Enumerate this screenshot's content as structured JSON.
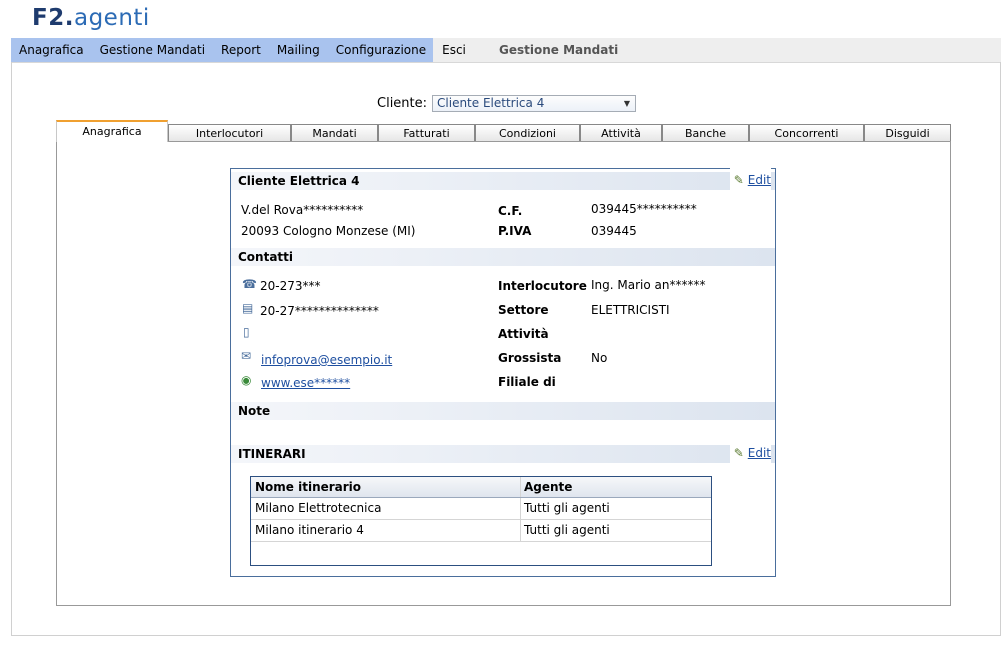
{
  "logo": {
    "part1": "F2",
    "part2": ".",
    "part3": "agenti"
  },
  "menu": {
    "items": [
      "Anagrafica",
      "Gestione Mandati",
      "Report",
      "Mailing",
      "Configurazione",
      "Esci"
    ]
  },
  "page_heading": "Gestione Mandati",
  "client_select": {
    "label": "Cliente:",
    "value": "Cliente Elettrica 4"
  },
  "tabs": [
    "Anagrafica",
    "Interlocutori",
    "Mandati",
    "Fatturati",
    "Condizioni",
    "Attività",
    "Banche",
    "Concorrenti",
    "Disguidi"
  ],
  "active_tab": "Anagrafica",
  "card": {
    "title": "Cliente Elettrica 4",
    "edit_label": "Edit",
    "address_line1": "V.del Rova**********",
    "address_line2": "20093 Cologno Monzese (MI)",
    "cf_label": "C.F.",
    "cf_value": "039445**********",
    "piva_label": "P.IVA",
    "piva_value": "039445",
    "contatti_title": "Contatti",
    "phone": "20-273***",
    "fax": "20-27**************",
    "mobile": "",
    "email": "infoprova@esempio.it",
    "website": "www.ese******",
    "interlocutore_label": "Interlocutore",
    "interlocutore_value": "Ing. Mario an******",
    "settore_label": "Settore",
    "settore_value": "ELETTRICISTI",
    "attivita_label": "Attività",
    "attivita_value": "",
    "grossista_label": "Grossista",
    "grossista_value": "No",
    "filiale_label": "Filiale di",
    "filiale_value": "",
    "note_title": "Note",
    "itinerari_title": "ITINERARI",
    "itinerari_edit_label": "Edit"
  },
  "itinerari_table": {
    "columns": [
      "Nome itinerario",
      "Agente"
    ],
    "rows": [
      [
        "Milano Elettrotecnica",
        "Tutti gli agenti"
      ],
      [
        "Milano itinerario 4",
        "Tutti gli agenti"
      ]
    ]
  }
}
